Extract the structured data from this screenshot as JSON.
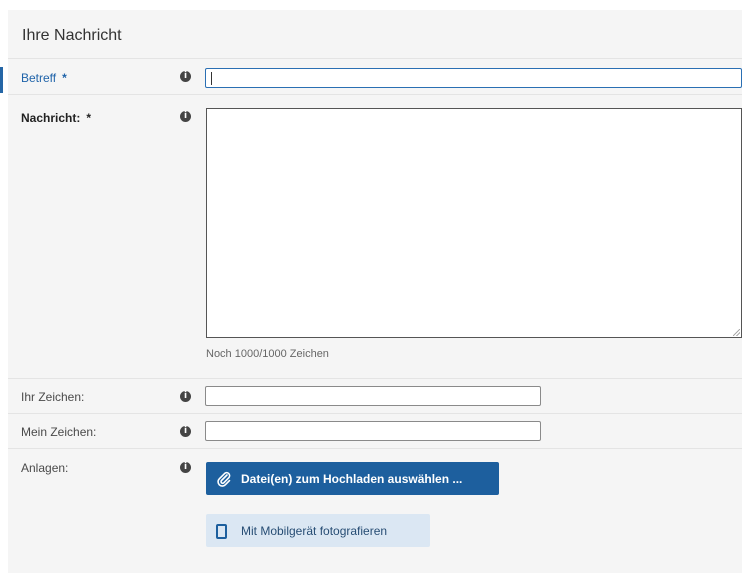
{
  "section": {
    "title": "Ihre Nachricht"
  },
  "fields": {
    "betreff": {
      "label": "Betreff",
      "required_mark": "*",
      "value": ""
    },
    "nachricht": {
      "label": "Nachricht:",
      "required_mark": "*",
      "value": "",
      "char_counter": "Noch 1000/1000 Zeichen"
    },
    "ihr_zeichen": {
      "label": "Ihr Zeichen:",
      "value": ""
    },
    "mein_zeichen": {
      "label": "Mein Zeichen:",
      "value": ""
    },
    "anlagen": {
      "label": "Anlagen:"
    }
  },
  "buttons": {
    "upload": {
      "label": "Datei(en) zum Hochladen auswählen ...",
      "icon": "paperclip-icon"
    },
    "mobile": {
      "label": "Mit Mobilgerät fotografieren",
      "icon": "mobile-phone-icon"
    }
  },
  "icons": {
    "info": "info-icon"
  },
  "colors": {
    "accent": "#1d5f9e",
    "active_label": "#1f63a9",
    "panel_bg": "#f5f5f5",
    "mobile_button_bg": "#dbe7f3"
  }
}
